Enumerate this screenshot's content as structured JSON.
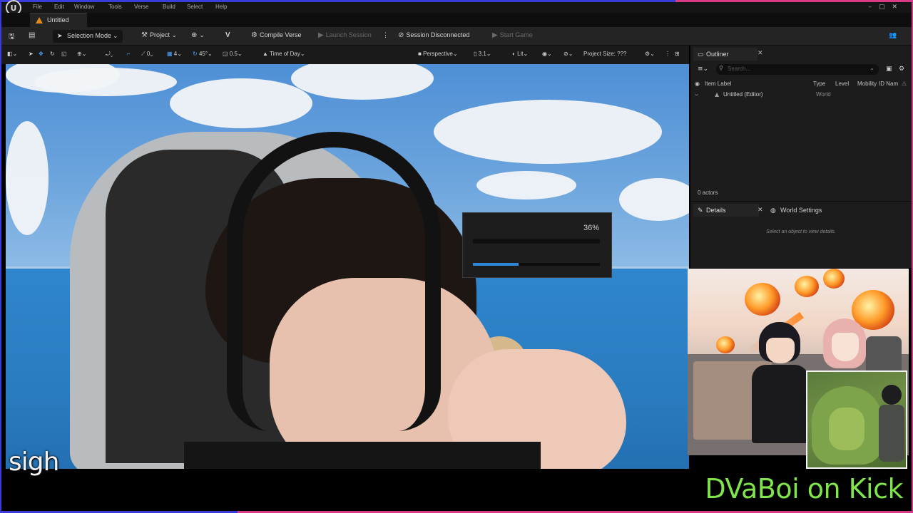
{
  "colors": {
    "frame_blue": "#3b3bd8",
    "frame_pink": "#d83b86",
    "editor_bg": "#242424",
    "accent_blue": "#2f87d8",
    "kick_green": "#7fe54a"
  },
  "menubar": {
    "logo_icon": "unreal-engine-logo",
    "items": [
      "File",
      "Edit",
      "Window",
      "Tools",
      "Verse",
      "Build",
      "Select",
      "Help"
    ]
  },
  "tabs": {
    "document": "Untitled"
  },
  "toolbar": {
    "selection_mode": "Selection Mode",
    "project": "Project",
    "compile_verse": "Compile Verse",
    "launch_session": "Launch Session",
    "session_status": "Session Disconnected",
    "start_game": "Start Game"
  },
  "viewport_toolbar": {
    "rotation_snap_value": "0",
    "grid_snap_value": "4",
    "angle_snap_value": "45°",
    "scale_snap_value": "0.5",
    "time_of_day": "Time of Day",
    "perspective": "Perspective",
    "fov_value": "3.1",
    "lit": "Lit",
    "project_size": "Project Size: ???"
  },
  "progress": {
    "percent_label": "36%",
    "fraction": 0.36
  },
  "outliner": {
    "title": "Outliner",
    "search_placeholder": "Search...",
    "columns": {
      "item_label": "Item Label",
      "type": "Type",
      "level": "Level",
      "mobility": "Mobility",
      "id_name": "ID Nam"
    },
    "rows": [
      {
        "label": "Untitled (Editor)",
        "type": "World"
      }
    ],
    "actor_count": "0 actors"
  },
  "details": {
    "title": "Details",
    "world_settings": "World Settings",
    "hint": "Select an object to view details."
  },
  "overlay": {
    "caption": "sigh",
    "channel": "DVaBoi on Kick"
  }
}
